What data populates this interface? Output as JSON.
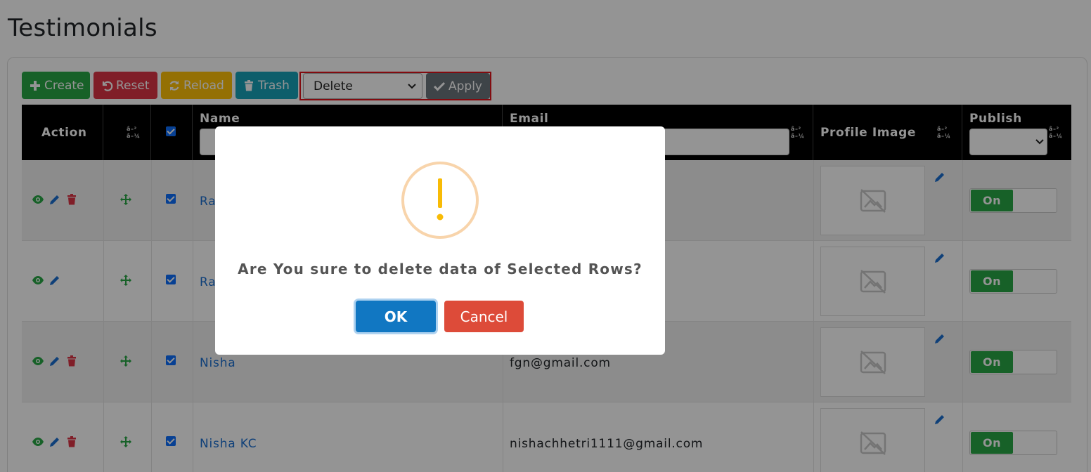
{
  "page": {
    "title": "Testimonials"
  },
  "toolbar": {
    "create_label": "Create",
    "reset_label": "Reset",
    "reload_label": "Reload",
    "trash_label": "Trash",
    "bulk_action_value": "Delete",
    "apply_label": "Apply"
  },
  "table": {
    "headers": {
      "action": "Action",
      "sort_glyph": "â–²\nâ–¼",
      "name": "Name",
      "email": "Email",
      "profile_image": "Profile Image",
      "publish": "Publish"
    },
    "rows": [
      {
        "name": "Ra",
        "email": "",
        "publish": "On",
        "has_delete": true
      },
      {
        "name": "Ra",
        "email": "",
        "publish": "On",
        "has_delete": false
      },
      {
        "name": "Nisha",
        "email": "fgn@gmail.com",
        "publish": "On",
        "has_delete": true
      },
      {
        "name": "Nisha KC",
        "email": "nishachhetri1111@gmail.com",
        "publish": "On",
        "has_delete": true
      }
    ]
  },
  "modal": {
    "icon": "exclamation-icon",
    "message": "Are You sure to delete data of Selected Rows?",
    "ok_label": "OK",
    "cancel_label": "Cancel"
  },
  "colors": {
    "create": "#28a745",
    "reset": "#dc3545",
    "reload": "#ffc107",
    "trash": "#17a2b8",
    "apply": "#6c757d",
    "ok": "#1177c2",
    "cancel": "#dd4b39",
    "link": "#1b6fd0"
  }
}
